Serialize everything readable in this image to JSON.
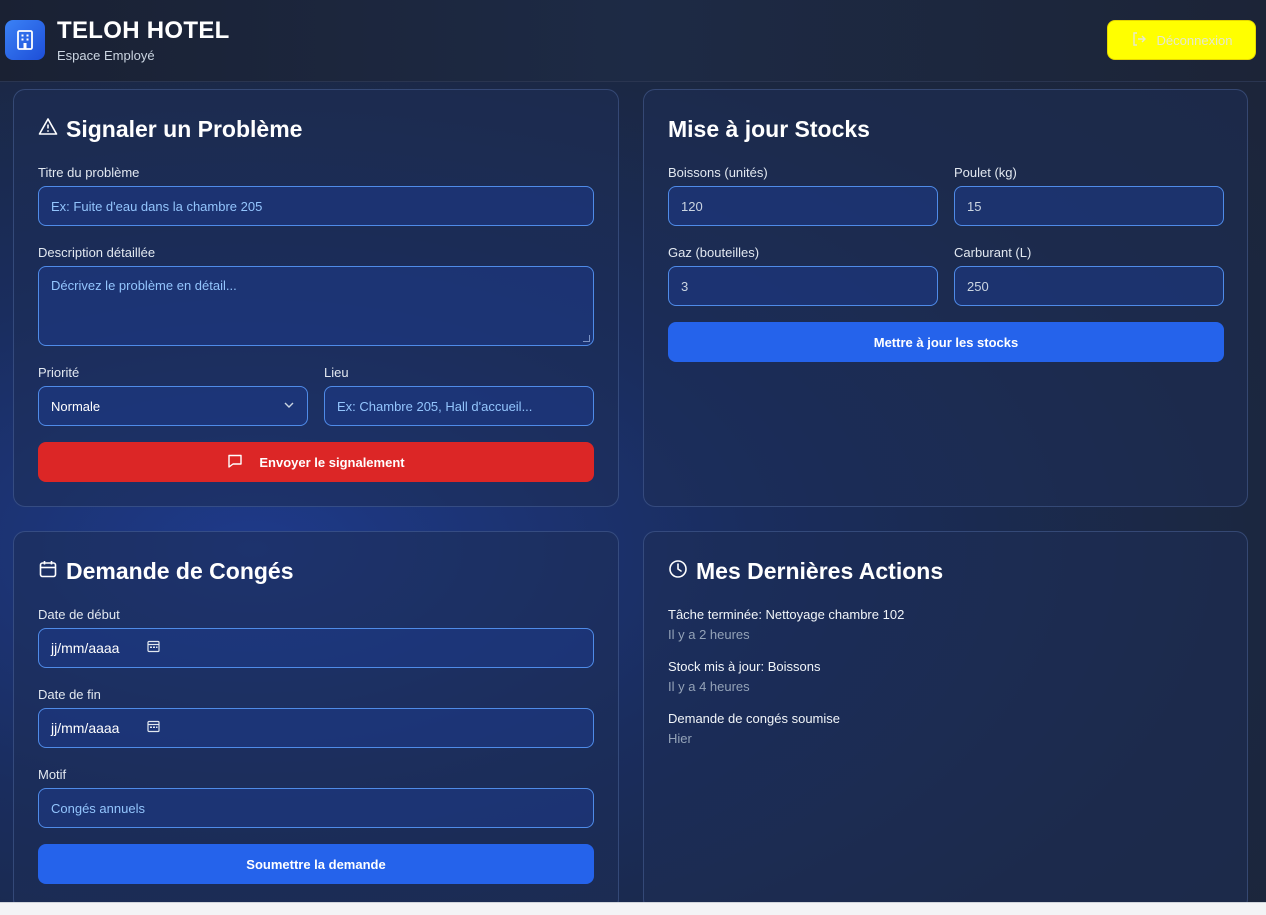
{
  "header": {
    "title": "TELOH HOTEL",
    "subtitle": "Espace Employé",
    "logout_label": "Déconnexion"
  },
  "problem": {
    "title": "Signaler un Problème",
    "title_field_label": "Titre du problème",
    "title_placeholder": "Ex: Fuite d'eau dans la chambre 205",
    "description_label": "Description détaillée",
    "description_placeholder": "Décrivez le problème en détail...",
    "priority_label": "Priorité",
    "priority_value": "Normale",
    "location_label": "Lieu",
    "location_placeholder": "Ex: Chambre 205, Hall d'accueil...",
    "submit_label": "Envoyer le signalement"
  },
  "stocks": {
    "title": "Mise à jour Stocks",
    "fields": [
      {
        "label": "Boissons (unités)",
        "value": "120"
      },
      {
        "label": "Poulet (kg)",
        "value": "15"
      },
      {
        "label": "Gaz (bouteilles)",
        "value": "3"
      },
      {
        "label": "Carburant (L)",
        "value": "250"
      }
    ],
    "submit_label": "Mettre à jour les stocks"
  },
  "leave": {
    "title": "Demande de Congés",
    "start_label": "Date de début",
    "start_placeholder": "jj/mm/aaaa",
    "end_label": "Date de fin",
    "end_placeholder": "jj/mm/aaaa",
    "reason_label": "Motif",
    "reason_placeholder": "Congés annuels",
    "submit_label": "Soumettre la demande"
  },
  "actions": {
    "title": "Mes Dernières Actions",
    "items": [
      {
        "title": "Tâche terminée: Nettoyage chambre 102",
        "time": "Il y a 2 heures"
      },
      {
        "title": "Stock mis à jour: Boissons",
        "time": "Il y a 4 heures"
      },
      {
        "title": "Demande de congés soumise",
        "time": "Hier"
      }
    ]
  },
  "colors": {
    "logout_bg": "#ffff00",
    "danger": "#dc2626",
    "primary": "#2563eb",
    "input_border": "#4f8be8"
  }
}
